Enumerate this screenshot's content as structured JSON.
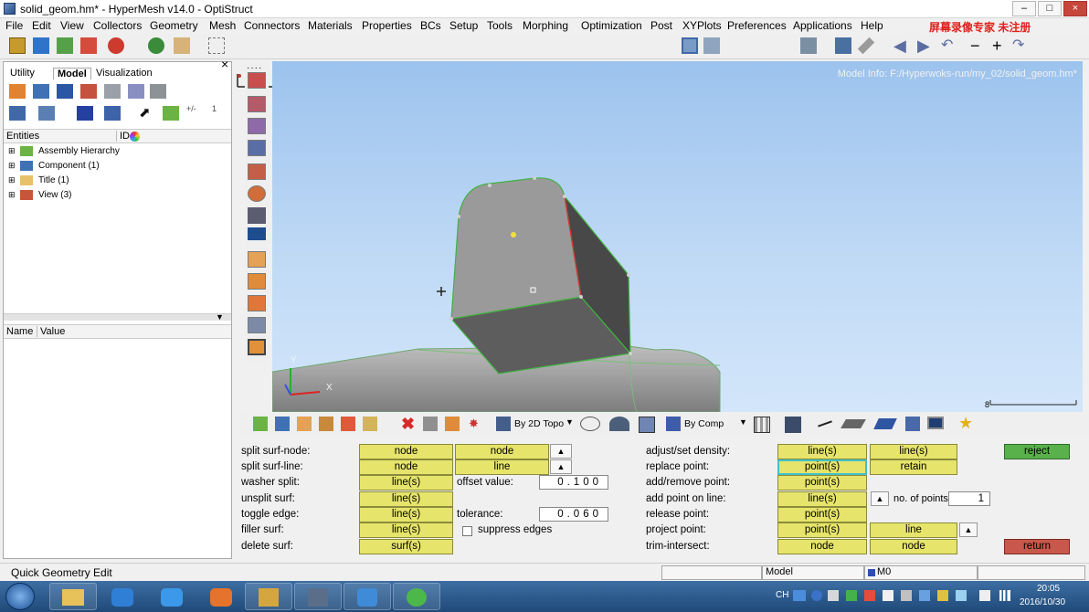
{
  "window": {
    "title": "solid_geom.hm* - HyperMesh v14.0 - OptiStruct"
  },
  "watermark": "屏幕录像专家 未注册",
  "menu": [
    "File",
    "Edit",
    "View",
    "Collectors",
    "Geometry",
    "Mesh",
    "Connectors",
    "Materials",
    "Properties",
    "BCs",
    "Setup",
    "Tools",
    "Morphing",
    "Optimization",
    "Post",
    "XYPlots",
    "Preferences",
    "Applications",
    "Help"
  ],
  "left_panel": {
    "tabs": [
      "Utility",
      "Model",
      "Visualization"
    ],
    "close_glyph": "×",
    "entity_header": {
      "entities": "Entities",
      "id": "ID"
    },
    "tree": [
      "Assembly Hierarchy",
      "Component (1)",
      "Title (1)",
      "View (3)"
    ],
    "props_header": {
      "name": "Name",
      "value": "Value"
    },
    "icon_labels": [
      "+/-",
      "1"
    ]
  },
  "viewport": {
    "model_info": "Model Info: F:/Hyperwoks-run/my_02/solid_geom.hm*",
    "scale_label": "8",
    "axis_y": "Y",
    "axis_x": "X"
  },
  "bottom_toolbar": {
    "topo_label": "By 2D Topo",
    "comp_label": "By Comp"
  },
  "panel": {
    "left_rows": [
      {
        "label": "split surf-node:",
        "btn1": "node",
        "btn2": "node"
      },
      {
        "label": "split surf-line:",
        "btn1": "node",
        "btn2": "line"
      },
      {
        "label": "washer split:",
        "btn1": "line(s)",
        "extra_label": "offset value:",
        "field": "0.100"
      },
      {
        "label": "unsplit surf:",
        "btn1": "line(s)"
      },
      {
        "label": "toggle edge:",
        "btn1": "line(s)",
        "extra_label": "tolerance:",
        "field": "0.060"
      },
      {
        "label": "filler surf:",
        "btn1": "line(s)",
        "extra_label": "suppress edges"
      },
      {
        "label": "delete surf:",
        "btn1": "surf(s)"
      }
    ],
    "right_rows": [
      {
        "label": "adjust/set density:",
        "btn1": "line(s)",
        "btn2": "line(s)"
      },
      {
        "label": "replace point:",
        "btn1": "point(s)",
        "btn2": "retain"
      },
      {
        "label": "add/remove point:",
        "btn1": "point(s)"
      },
      {
        "label": "add point on line:",
        "btn1": "line(s)",
        "extra_label": "no. of points",
        "field": "1"
      },
      {
        "label": "release point:",
        "btn1": "point(s)"
      },
      {
        "label": "project point:",
        "btn1": "point(s)",
        "btn2": "line"
      },
      {
        "label": "trim-intersect:",
        "btn1": "node",
        "btn2": "node"
      }
    ],
    "reject": "reject",
    "return": "return"
  },
  "status": {
    "mode": "Quick Geometry Edit",
    "model": "Model",
    "comp": "M0"
  },
  "tray": {
    "lang": "CH",
    "time": "20:05",
    "date": "2016/10/30"
  }
}
